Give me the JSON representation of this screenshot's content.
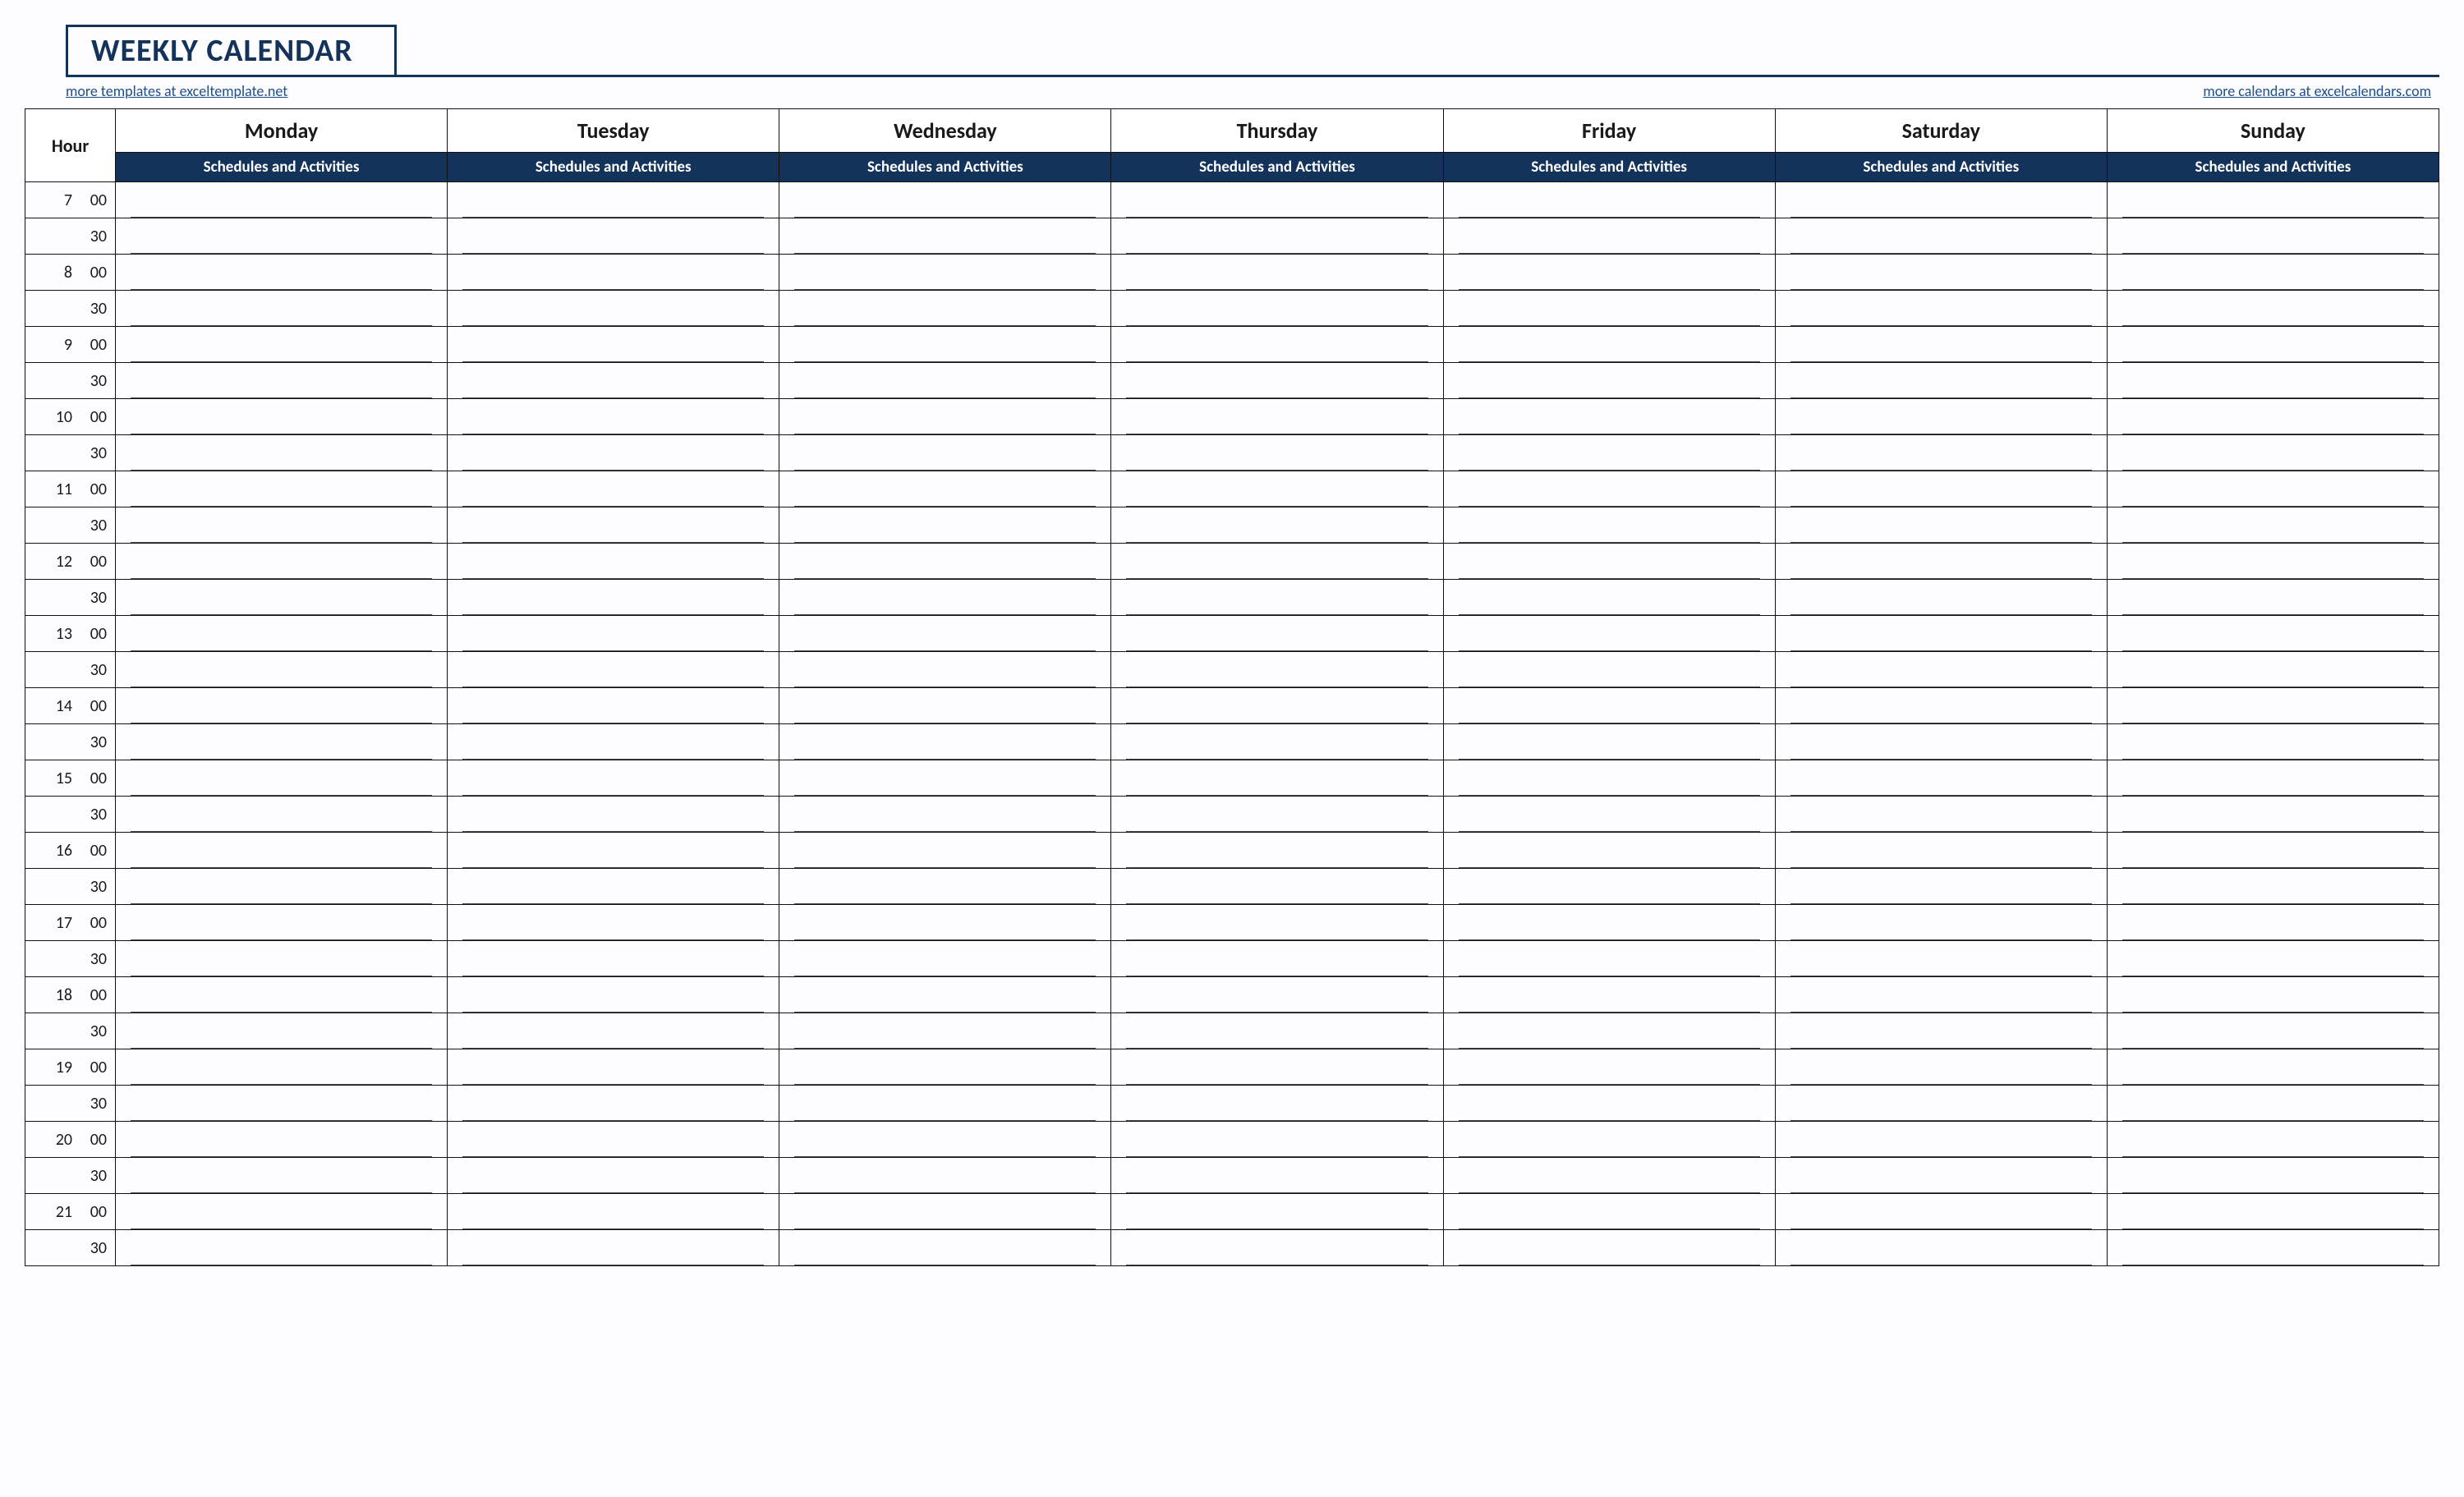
{
  "title": "WEEKLY CALENDAR",
  "links": {
    "left": "more templates at exceltemplate.net",
    "right": "more calendars at excelcalendars.com"
  },
  "hour_label": "Hour",
  "subheader": "Schedules and Activities",
  "days": [
    "Monday",
    "Tuesday",
    "Wednesday",
    "Thursday",
    "Friday",
    "Saturday",
    "Sunday"
  ],
  "time_slots": [
    {
      "hour": "7",
      "minute": "00"
    },
    {
      "hour": "",
      "minute": "30"
    },
    {
      "hour": "8",
      "minute": "00"
    },
    {
      "hour": "",
      "minute": "30"
    },
    {
      "hour": "9",
      "minute": "00"
    },
    {
      "hour": "",
      "minute": "30"
    },
    {
      "hour": "10",
      "minute": "00"
    },
    {
      "hour": "",
      "minute": "30"
    },
    {
      "hour": "11",
      "minute": "00"
    },
    {
      "hour": "",
      "minute": "30"
    },
    {
      "hour": "12",
      "minute": "00"
    },
    {
      "hour": "",
      "minute": "30"
    },
    {
      "hour": "13",
      "minute": "00"
    },
    {
      "hour": "",
      "minute": "30"
    },
    {
      "hour": "14",
      "minute": "00"
    },
    {
      "hour": "",
      "minute": "30"
    },
    {
      "hour": "15",
      "minute": "00"
    },
    {
      "hour": "",
      "minute": "30"
    },
    {
      "hour": "16",
      "minute": "00"
    },
    {
      "hour": "",
      "minute": "30"
    },
    {
      "hour": "17",
      "minute": "00"
    },
    {
      "hour": "",
      "minute": "30"
    },
    {
      "hour": "18",
      "minute": "00"
    },
    {
      "hour": "",
      "minute": "30"
    },
    {
      "hour": "19",
      "minute": "00"
    },
    {
      "hour": "",
      "minute": "30"
    },
    {
      "hour": "20",
      "minute": "00"
    },
    {
      "hour": "",
      "minute": "30"
    },
    {
      "hour": "21",
      "minute": "00"
    },
    {
      "hour": "",
      "minute": "30"
    }
  ]
}
